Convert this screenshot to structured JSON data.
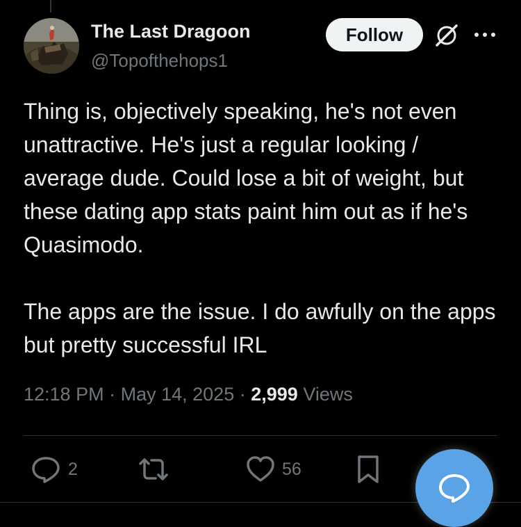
{
  "post": {
    "author": {
      "display_name": "The Last Dragoon",
      "handle": "@Topofthehops1"
    },
    "follow_label": "Follow",
    "text_paragraph_1": "Thing is, objectively speaking, he's not even unattractive. He's just a regular looking / average dude. Could lose a bit of weight, but these dating app stats paint him out as if he's Quasimodo.",
    "text_paragraph_2": "The apps are the issue. I do awfully on the apps but pretty successful IRL",
    "time": "12:18 PM",
    "separator": "·",
    "date": "May 14, 2025",
    "views_count": "2,999",
    "views_label": "Views"
  },
  "actions": {
    "reply_count": "2",
    "like_count": "56"
  },
  "icons": {
    "grok": "grok-icon",
    "more": "more-icon",
    "reply": "reply-icon",
    "repost": "repost-icon",
    "like": "heart-icon",
    "bookmark": "bookmark-icon",
    "compose": "reply-compose-icon"
  },
  "colors": {
    "background": "#000000",
    "text": "#e7e9ea",
    "muted": "#71767b",
    "follow_bg": "#eff3f4",
    "fab": "#5aa3e6"
  }
}
